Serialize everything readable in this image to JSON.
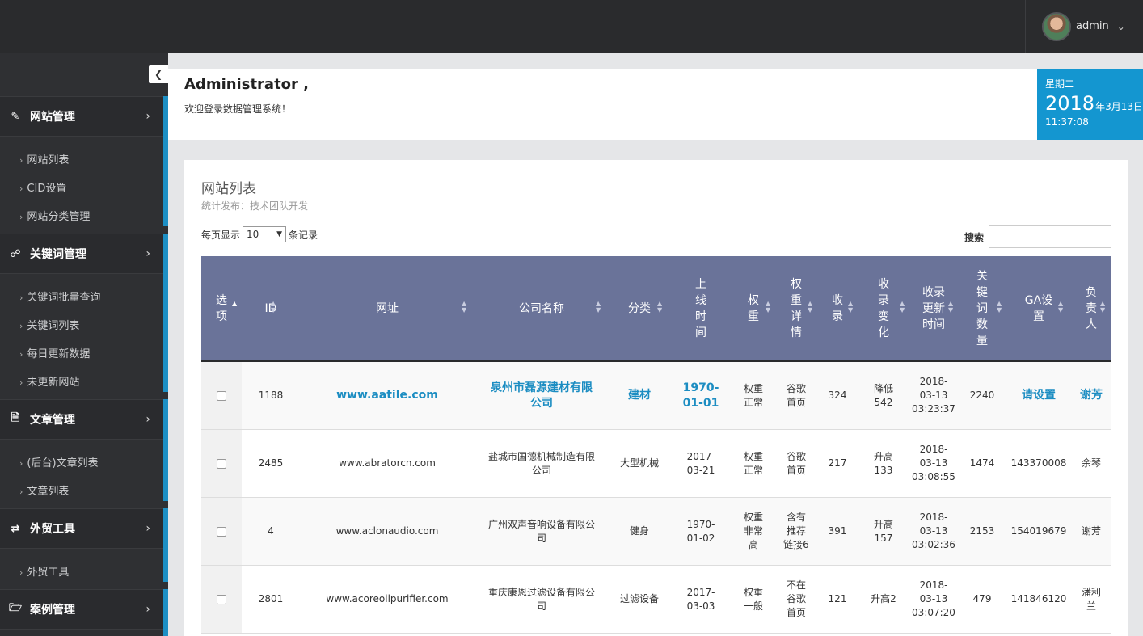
{
  "header": {
    "user_name": "admin"
  },
  "sidebar": {
    "groups": [
      {
        "label": "网站管理",
        "icon": "edit-icon",
        "items": [
          "网站列表",
          "CID设置",
          "网站分类管理"
        ]
      },
      {
        "label": "关键词管理",
        "icon": "link-icon",
        "items": [
          "关键词批量查询",
          "关键词列表",
          "每日更新数据",
          "未更新网站"
        ]
      },
      {
        "label": "文章管理",
        "icon": "document-icon",
        "items": [
          "(后台)文章列表",
          "文章列表"
        ]
      },
      {
        "label": "外贸工具",
        "icon": "shuffle-icon",
        "items": [
          "外贸工具"
        ]
      },
      {
        "label": "案例管理",
        "icon": "folder-open-icon",
        "items": []
      }
    ]
  },
  "welcome": {
    "title": "Administrator ,",
    "subtitle": "欢迎登录数据管理系统！",
    "weekday": "星期二",
    "year": "2018",
    "month_day": "年3月13日",
    "time": "11:37:08"
  },
  "panel": {
    "title": "网站列表",
    "subtitle": "统计发布：技术团队开发",
    "length_prefix": "每页显示",
    "length_value": "10",
    "length_suffix": "条记录",
    "search_label": "搜索"
  },
  "table": {
    "columns": [
      "选\n项",
      "ID",
      "网址",
      "公司名称",
      "分类",
      "上\n线\n时\n间",
      "权\n重",
      "权\n重\n详\n情",
      "收\n录",
      "收\n录\n变\n化",
      "收录\n更新\n时间",
      "关\n键\n词\n数\n量",
      "GA设\n置",
      "负\n责\n人"
    ],
    "rows": [
      [
        "1188",
        "www.aatile.com",
        "泉州市磊源建材有限\n公司",
        "建材",
        "1970-\n01-01",
        "权重\n正常",
        "谷歌\n首页",
        "324",
        "降低\n542",
        "2018-\n03-13\n03:23:37",
        "2240",
        "请设置",
        "谢芳"
      ],
      [
        "2485",
        "www.abratorcn.com",
        "盐城市国德机械制造有限\n公司",
        "大型机械",
        "2017-\n03-21",
        "权重\n正常",
        "谷歌\n首页",
        "217",
        "升高\n133",
        "2018-\n03-13\n03:08:55",
        "1474",
        "143370008",
        "余琴"
      ],
      [
        "4",
        "www.aclonaudio.com",
        "广州双声音响设备有限公\n司",
        "健身",
        "1970-\n01-02",
        "权重\n非常\n高",
        "含有\n推荐\n链接6",
        "391",
        "升高\n157",
        "2018-\n03-13\n03:02:36",
        "2153",
        "154019679",
        "谢芳"
      ],
      [
        "2801",
        "www.acoreoilpurifier.com",
        "重庆康恩过滤设备有限公\n司",
        "过滤设备",
        "2017-\n03-03",
        "权重\n一般",
        "不在\n谷歌\n首页",
        "121",
        "升高2",
        "2018-\n03-13\n03:07:20",
        "479",
        "141846120",
        "潘利\n兰"
      ]
    ]
  },
  "colors": {
    "topbar": "#2a2b2d",
    "sidebar": "#2f3033",
    "accent_blue": "#1496d0",
    "table_header": "#6a7399",
    "link": "#1c8dc2"
  }
}
